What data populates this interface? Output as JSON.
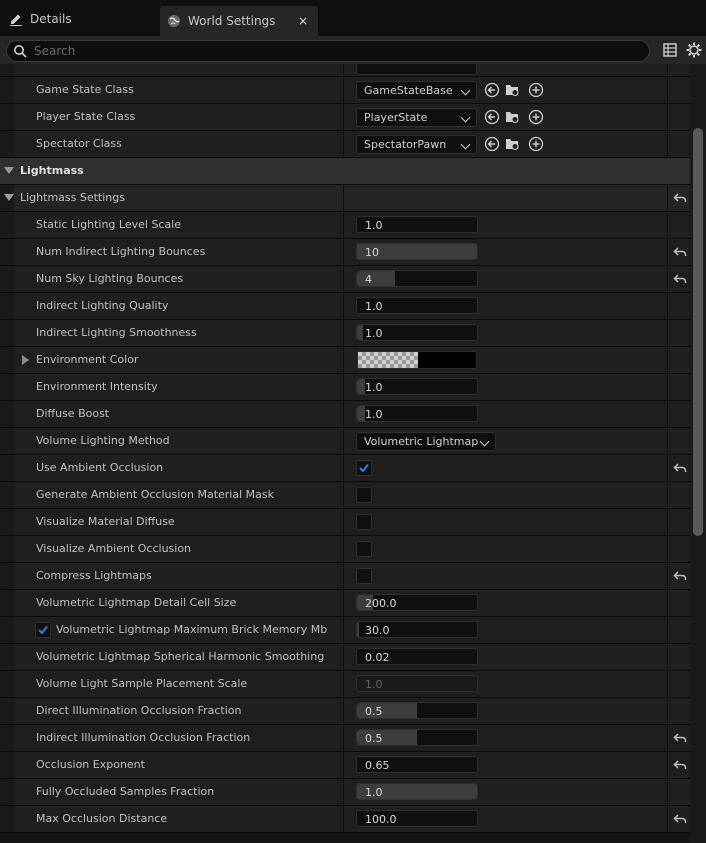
{
  "tabs": [
    {
      "label": "Details",
      "icon": "pencil-icon"
    },
    {
      "label": "World Settings",
      "icon": "globe-icon",
      "close": "×"
    }
  ],
  "search": {
    "placeholder": "Search"
  },
  "toolbar_icons": [
    "table-icon",
    "gear-icon"
  ],
  "top_rows": [
    {
      "label": "Game State Class",
      "value": "GameStateBase"
    },
    {
      "label": "Player State Class",
      "value": "PlayerState"
    },
    {
      "label": "Spectator Class",
      "value": "SpectatorPawn"
    }
  ],
  "category": {
    "label": "Lightmass"
  },
  "subcategory": {
    "label": "Lightmass Settings"
  },
  "rows": [
    {
      "label": "Static Lighting Level Scale",
      "type": "number",
      "value": "1.0",
      "fill": 0,
      "reset": false
    },
    {
      "label": "Num Indirect Lighting Bounces",
      "type": "number",
      "value": "10",
      "fill": 1.0,
      "reset": true
    },
    {
      "label": "Num Sky Lighting Bounces",
      "type": "number",
      "value": "4",
      "fill": 0.32,
      "reset": true
    },
    {
      "label": "Indirect Lighting Quality",
      "type": "number",
      "value": "1.0",
      "fill": 0,
      "reset": false
    },
    {
      "label": "Indirect Lighting Smoothness",
      "type": "number",
      "value": "1.0",
      "fill": 0.05,
      "reset": false
    },
    {
      "label": "Environment Color",
      "type": "color",
      "value": "",
      "reset": false,
      "expandable": true
    },
    {
      "label": "Environment Intensity",
      "type": "number",
      "value": "1.0",
      "fill": 0.07,
      "reset": false
    },
    {
      "label": "Diffuse Boost",
      "type": "number",
      "value": "1.0",
      "fill": 0.07,
      "reset": false
    },
    {
      "label": "Volume Lighting Method",
      "type": "combo",
      "value": "Volumetric Lightmap",
      "reset": false
    },
    {
      "label": "Use Ambient Occlusion",
      "type": "check",
      "checked": true,
      "reset": true
    },
    {
      "label": "Generate Ambient Occlusion Material Mask",
      "type": "check",
      "checked": false,
      "reset": false
    },
    {
      "label": "Visualize Material Diffuse",
      "type": "check",
      "checked": false,
      "reset": false
    },
    {
      "label": "Visualize Ambient Occlusion",
      "type": "check",
      "checked": false,
      "reset": false
    },
    {
      "label": "Compress Lightmaps",
      "type": "check",
      "checked": false,
      "reset": true
    },
    {
      "label": "Volumetric Lightmap Detail Cell Size",
      "type": "number",
      "value": "200.0",
      "fill": 0.13,
      "reset": false
    },
    {
      "label": "Volumetric Lightmap Maximum Brick Memory Mb",
      "type": "number",
      "value": "30.0",
      "fill": 0.02,
      "reset": false,
      "leading_check": true
    },
    {
      "label": "Volumetric Lightmap Spherical Harmonic Smoothing",
      "type": "number",
      "value": "0.02",
      "fill": 0,
      "reset": false
    },
    {
      "label": "Volume Light Sample Placement Scale",
      "type": "number",
      "value": "1.0",
      "fill": 0,
      "reset": false,
      "disabled": true
    },
    {
      "label": "Direct Illumination Occlusion Fraction",
      "type": "number",
      "value": "0.5",
      "fill": 0.5,
      "reset": false
    },
    {
      "label": "Indirect Illumination Occlusion Fraction",
      "type": "number",
      "value": "0.5",
      "fill": 0.5,
      "reset": true
    },
    {
      "label": "Occlusion Exponent",
      "type": "number",
      "value": "0.65",
      "fill": 0,
      "reset": true
    },
    {
      "label": "Fully Occluded Samples Fraction",
      "type": "number",
      "value": "1.0",
      "fill": 1.0,
      "reset": false
    },
    {
      "label": "Max Occlusion Distance",
      "type": "number",
      "value": "100.0",
      "fill": 0,
      "reset": true
    }
  ],
  "colors": {
    "accent": "#1a73e8",
    "panel": "#1f1f1f",
    "category": "#2f2f2f"
  }
}
